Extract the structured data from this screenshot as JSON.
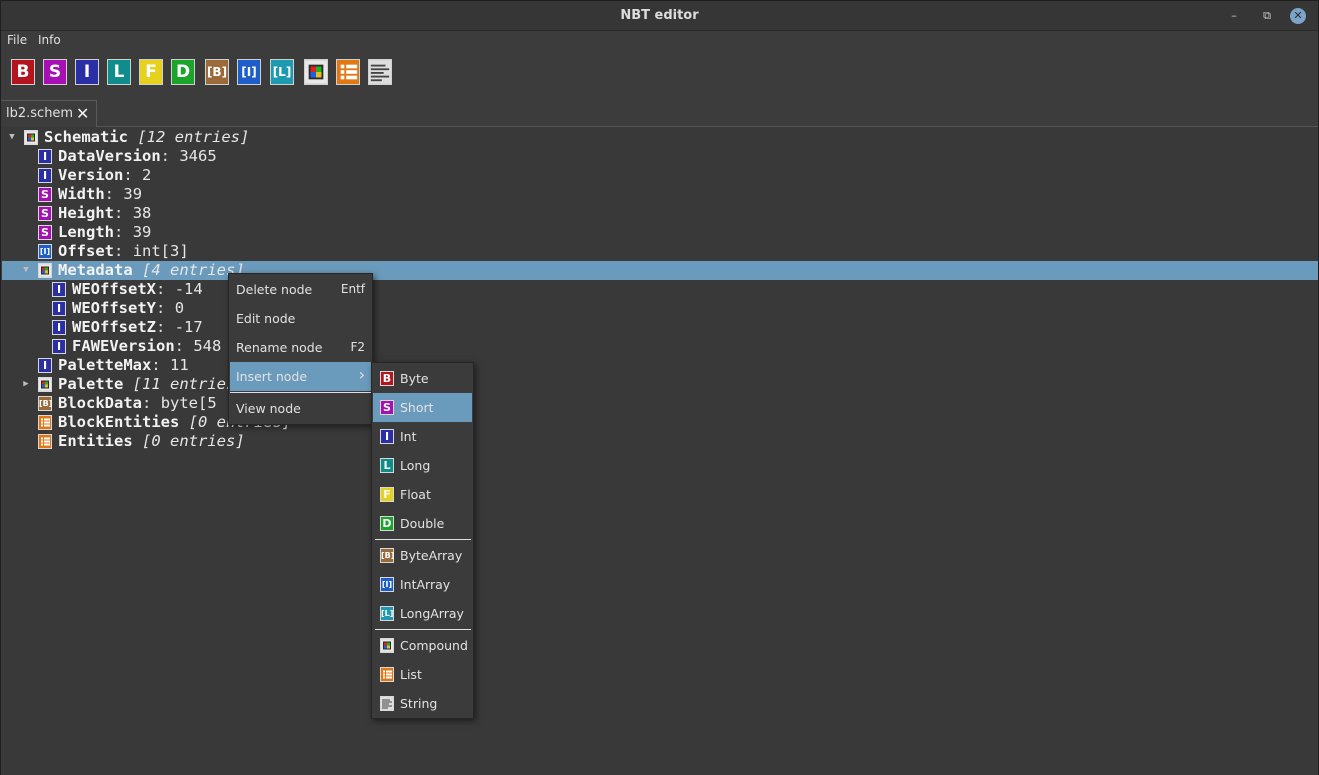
{
  "window": {
    "title": "NBT editor"
  },
  "menubar": {
    "file": "File",
    "info": "Info"
  },
  "toolbar": {
    "buttons": [
      {
        "name": "byte",
        "glyph": "B",
        "color": "#b4141e"
      },
      {
        "name": "short",
        "glyph": "S",
        "color": "#a60fb4"
      },
      {
        "name": "int",
        "glyph": "I",
        "color": "#2b2fa6"
      },
      {
        "name": "long",
        "glyph": "L",
        "color": "#0f8c8c"
      },
      {
        "name": "float",
        "glyph": "F",
        "color": "#e6d21e"
      },
      {
        "name": "double",
        "glyph": "D",
        "color": "#1aa52a"
      },
      {
        "name": "byte-array",
        "glyph": "[B]",
        "color": "#9a6a3a"
      },
      {
        "name": "int-array",
        "glyph": "[I]",
        "color": "#1e5ec8"
      },
      {
        "name": "long-array",
        "glyph": "[L]",
        "color": "#1e9ab0"
      },
      {
        "name": "compound",
        "glyph": "",
        "color": "#d8d8d8"
      },
      {
        "name": "list",
        "glyph": "",
        "color": "#e07814"
      },
      {
        "name": "string",
        "glyph": "",
        "color": "#d8d8d8"
      }
    ]
  },
  "tab": {
    "label": "lb2.schem",
    "close": "✕"
  },
  "tree": {
    "rows": [
      {
        "type": "compound",
        "glyph": "",
        "name": "Schematic",
        "sep": "",
        "value": "[12 entries]",
        "italic": true,
        "expanded": true
      },
      {
        "type": "int",
        "glyph": "I",
        "name": "DataVersion",
        "sep": ":",
        "value": "3465"
      },
      {
        "type": "int",
        "glyph": "I",
        "name": "Version",
        "sep": ":",
        "value": "2"
      },
      {
        "type": "short",
        "glyph": "S",
        "name": "Width",
        "sep": ":",
        "value": "39"
      },
      {
        "type": "short",
        "glyph": "S",
        "name": "Height",
        "sep": ":",
        "value": "38"
      },
      {
        "type": "short",
        "glyph": "S",
        "name": "Length",
        "sep": ":",
        "value": "39"
      },
      {
        "type": "int-array",
        "glyph": "[I]",
        "name": "Offset",
        "sep": ":",
        "value": "int[3]"
      },
      {
        "type": "compound",
        "glyph": "",
        "name": "Metadata",
        "sep": "",
        "value": "[4 entries]",
        "italic": true,
        "expanded": true,
        "selected": true
      },
      {
        "type": "int",
        "glyph": "I",
        "name": "WEOffsetX",
        "sep": ":",
        "value": "-14"
      },
      {
        "type": "int",
        "glyph": "I",
        "name": "WEOffsetY",
        "sep": ":",
        "value": "0"
      },
      {
        "type": "int",
        "glyph": "I",
        "name": "WEOffsetZ",
        "sep": ":",
        "value": "-17"
      },
      {
        "type": "int",
        "glyph": "I",
        "name": "FAWEVersion",
        "sep": ":",
        "value": "548"
      },
      {
        "type": "int",
        "glyph": "I",
        "name": "PaletteMax",
        "sep": ":",
        "value": "11"
      },
      {
        "type": "compound",
        "glyph": "",
        "name": "Palette",
        "sep": "",
        "value": "[11 entries]",
        "italic": true,
        "collapsed": true
      },
      {
        "type": "byte-array",
        "glyph": "[B]",
        "name": "BlockData",
        "sep": ":",
        "value": "byte[5"
      },
      {
        "type": "list",
        "glyph": "",
        "name": "BlockEntities",
        "sep": "",
        "value": "[0 entries]",
        "italic": true
      },
      {
        "type": "list",
        "glyph": "",
        "name": "Entities",
        "sep": "",
        "value": "[0 entries]",
        "italic": true
      }
    ]
  },
  "context_menu": {
    "delete": {
      "label": "Delete node",
      "shortcut": "Entf"
    },
    "edit": {
      "label": "Edit node"
    },
    "rename": {
      "label": "Rename node",
      "shortcut": "F2"
    },
    "insert": {
      "label": "Insert node",
      "arrow": "›"
    },
    "view": {
      "label": "View node"
    }
  },
  "insert_submenu": {
    "items": [
      {
        "type": "byte",
        "glyph": "B",
        "label": "Byte"
      },
      {
        "type": "short",
        "glyph": "S",
        "label": "Short",
        "active": true
      },
      {
        "type": "int",
        "glyph": "I",
        "label": "Int"
      },
      {
        "type": "long",
        "glyph": "L",
        "label": "Long"
      },
      {
        "type": "float",
        "glyph": "F",
        "label": "Float"
      },
      {
        "type": "double",
        "glyph": "D",
        "label": "Double"
      },
      {
        "type": "byte-array",
        "glyph": "[B]",
        "label": "ByteArray"
      },
      {
        "type": "int-array",
        "glyph": "[I]",
        "label": "IntArray"
      },
      {
        "type": "long-array",
        "glyph": "[L]",
        "label": "LongArray"
      },
      {
        "type": "compound",
        "glyph": "",
        "label": "Compound"
      },
      {
        "type": "list",
        "glyph": "",
        "label": "List"
      },
      {
        "type": "string",
        "glyph": "",
        "label": "String"
      }
    ]
  },
  "colors": {
    "selection": "#6b9bbc",
    "background": "#393939",
    "close_button": "#7aa4c9"
  }
}
